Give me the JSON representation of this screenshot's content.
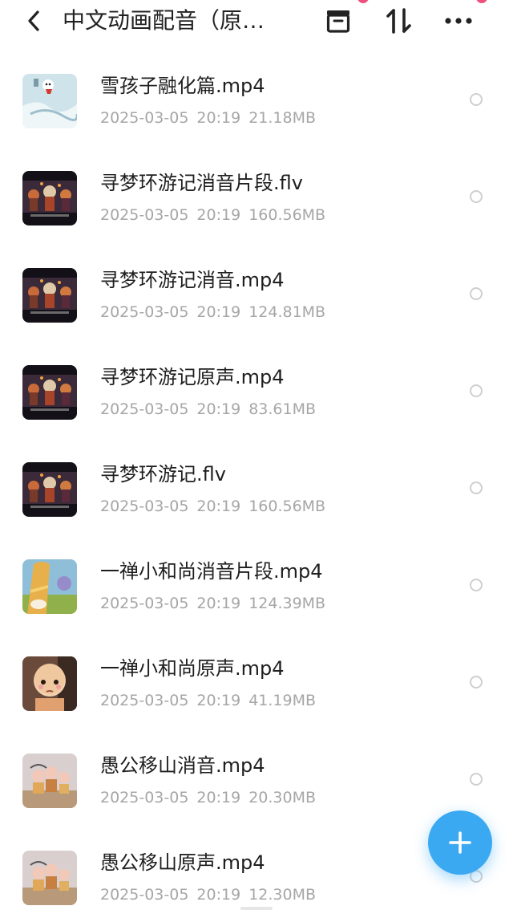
{
  "header": {
    "title": "中文动画配音（原…",
    "back_icon": "chevron-left-icon",
    "archive_icon": "archive-box-icon",
    "sort_icon": "sort-arrows-icon",
    "more_icon": "more-horizontal-icon",
    "accent_dot_color": "#ef4f7e"
  },
  "files": [
    {
      "name": "雪孩子融化篇.mp4",
      "date": "2025-03-05",
      "time": "20:19",
      "size": "21.18MB",
      "thumb": "snow"
    },
    {
      "name": "寻梦环游记消音片段.flv",
      "date": "2025-03-05",
      "time": "20:19",
      "size": "160.56MB",
      "thumb": "coco"
    },
    {
      "name": "寻梦环游记消音.mp4",
      "date": "2025-03-05",
      "time": "20:19",
      "size": "124.81MB",
      "thumb": "coco"
    },
    {
      "name": "寻梦环游记原声.mp4",
      "date": "2025-03-05",
      "time": "20:19",
      "size": "83.61MB",
      "thumb": "coco"
    },
    {
      "name": "寻梦环游记.flv",
      "date": "2025-03-05",
      "time": "20:19",
      "size": "160.56MB",
      "thumb": "coco"
    },
    {
      "name": "一禅小和尚消音片段.mp4",
      "date": "2025-03-05",
      "time": "20:19",
      "size": "124.39MB",
      "thumb": "monk1"
    },
    {
      "name": "一禅小和尚原声.mp4",
      "date": "2025-03-05",
      "time": "20:19",
      "size": "41.19MB",
      "thumb": "monk2"
    },
    {
      "name": "愚公移山消音.mp4",
      "date": "2025-03-05",
      "time": "20:19",
      "size": "20.30MB",
      "thumb": "yugong"
    },
    {
      "name": "愚公移山原声.mp4",
      "date": "2025-03-05",
      "time": "20:19",
      "size": "12.30MB",
      "thumb": "yugong"
    }
  ],
  "fab": {
    "icon": "plus-icon",
    "color": "#3aa9f2"
  }
}
